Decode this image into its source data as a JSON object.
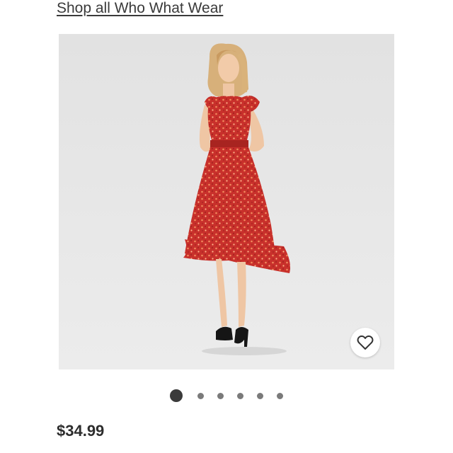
{
  "header": {
    "shop_link_label": "Shop all Who What Wear"
  },
  "gallery": {
    "image_count": 6,
    "active_index": 0,
    "favorite_icon": "heart-outline-icon"
  },
  "product": {
    "price": "$34.99"
  },
  "colors": {
    "dress_red": "#c8302b",
    "dot_active": "#3b3b3b",
    "dot_inactive": "#7a7a7a",
    "photo_background": "#e6e6e6"
  }
}
